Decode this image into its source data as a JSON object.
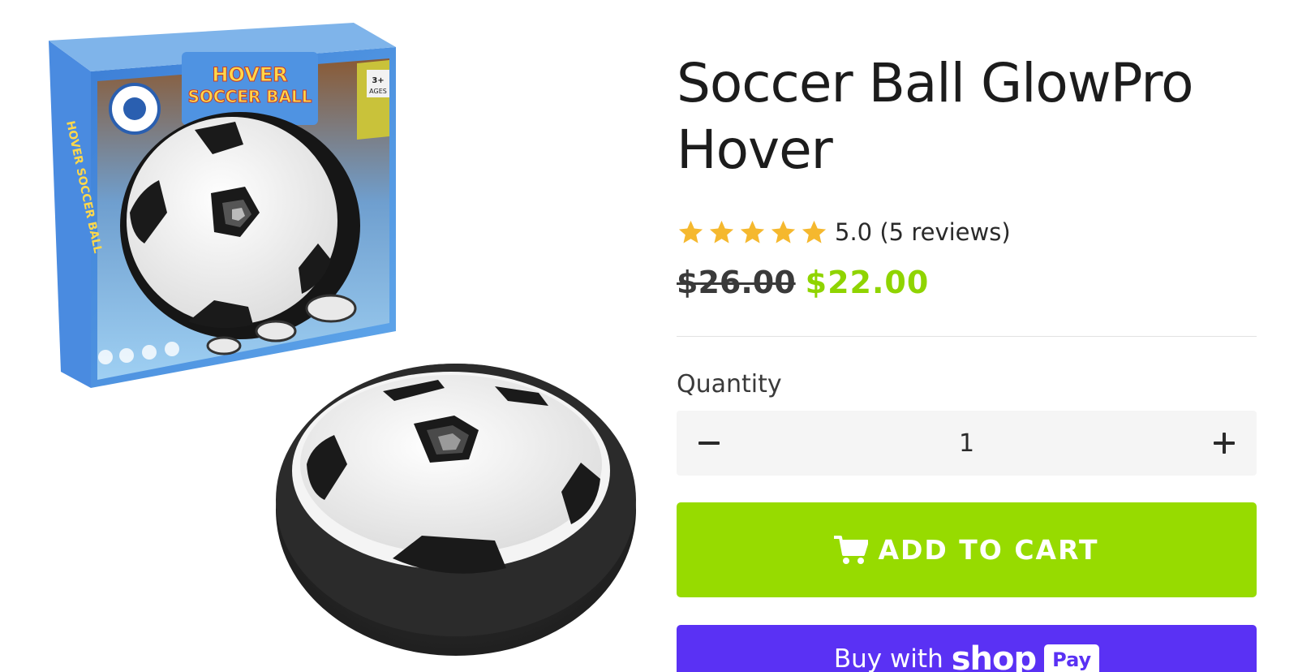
{
  "product": {
    "title": "Soccer Ball GlowPro Hover",
    "image_alt": "Hover soccer ball in retail box and standalone hover disc",
    "box_text": {
      "brand_line1": "HOVER",
      "brand_line2": "SOCCER BALL",
      "age_badge": "3+ AGES"
    }
  },
  "rating": {
    "stars_filled": 5,
    "stars_total": 5,
    "star_color": "#F5B82E",
    "text": "5.0 (5 reviews)"
  },
  "price": {
    "compare_at": "$26.00",
    "sale": "$22.00",
    "sale_color": "#8FD400"
  },
  "quantity": {
    "label": "Quantity",
    "value": "1",
    "decrease_icon": "minus-icon",
    "increase_icon": "plus-icon"
  },
  "buttons": {
    "add_to_cart": {
      "label": "ADD TO CART",
      "icon": "cart-icon",
      "color": "#97DB00"
    },
    "shop_pay": {
      "prefix": "Buy with",
      "brand": "shop",
      "badge": "Pay",
      "color": "#5A31F4"
    }
  }
}
